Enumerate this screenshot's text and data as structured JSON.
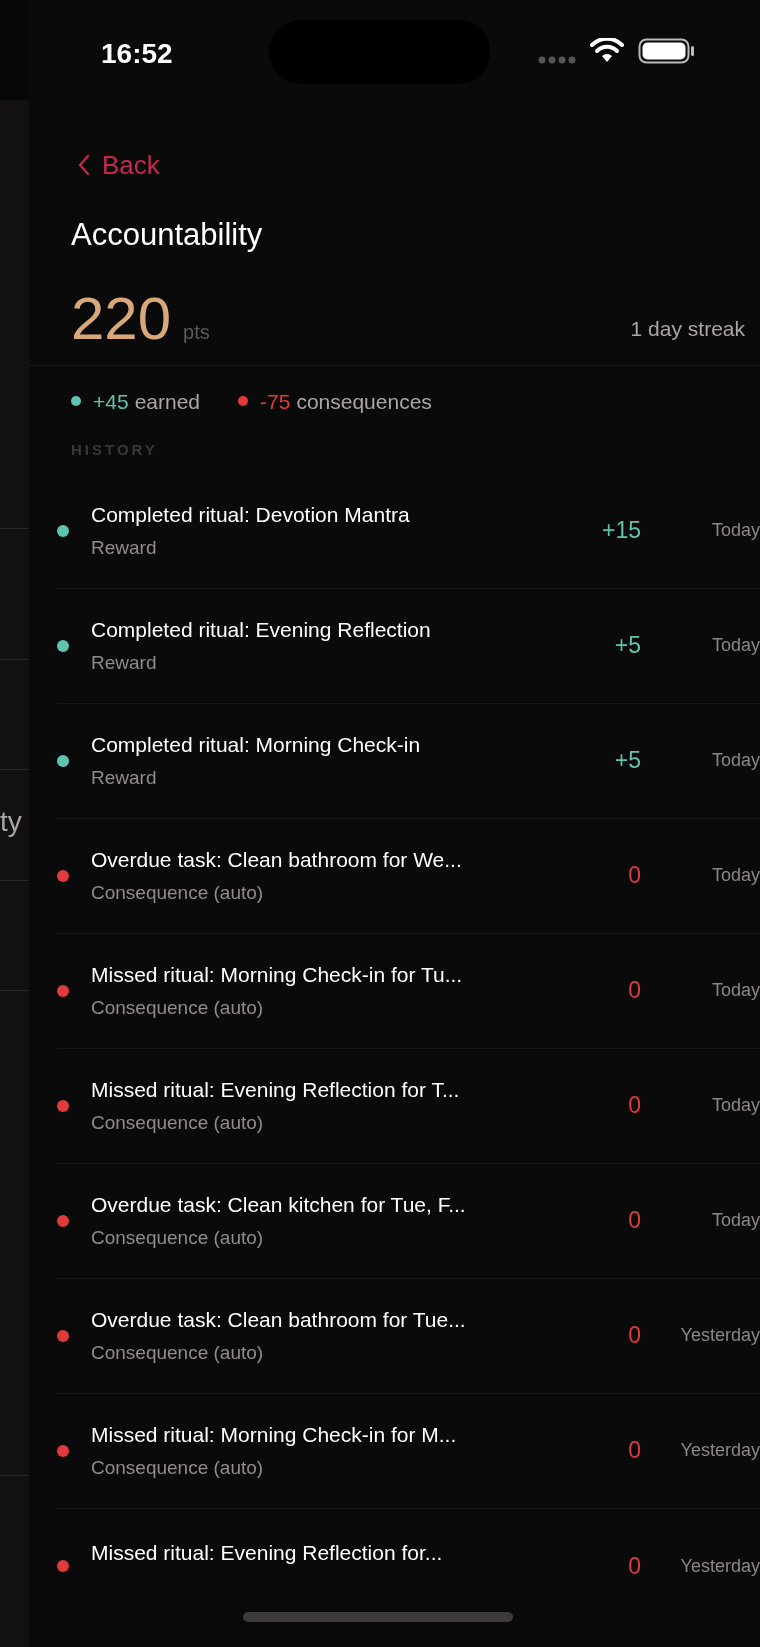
{
  "status_bar": {
    "time": "16:52"
  },
  "background_panel": {
    "text": "ty"
  },
  "back": {
    "label": "Back"
  },
  "title": "Accountability",
  "points": {
    "value": "220",
    "unit": "pts",
    "streak": "1 day streak"
  },
  "stats": [
    {
      "kind": "reward",
      "value": "+45",
      "label": "earned"
    },
    {
      "kind": "consequence",
      "value": "-75",
      "label": "consequences"
    }
  ],
  "history_heading": "HISTORY",
  "history": [
    {
      "kind": "reward",
      "title": "Completed ritual: Devotion Mantra",
      "subtitle": "Reward",
      "amount": "+15",
      "date": "Today"
    },
    {
      "kind": "reward",
      "title": "Completed ritual: Evening Reflection",
      "subtitle": "Reward",
      "amount": "+5",
      "date": "Today"
    },
    {
      "kind": "reward",
      "title": "Completed ritual: Morning Check-in",
      "subtitle": "Reward",
      "amount": "+5",
      "date": "Today"
    },
    {
      "kind": "consequence",
      "title": "Overdue task: Clean bathroom for We...",
      "subtitle": "Consequence (auto)",
      "amount": "0",
      "date": "Today"
    },
    {
      "kind": "consequence",
      "title": "Missed ritual: Morning Check-in for Tu...",
      "subtitle": "Consequence (auto)",
      "amount": "0",
      "date": "Today"
    },
    {
      "kind": "consequence",
      "title": "Missed ritual: Evening Reflection for T...",
      "subtitle": "Consequence (auto)",
      "amount": "0",
      "date": "Today"
    },
    {
      "kind": "consequence",
      "title": "Overdue task: Clean kitchen for Tue, F...",
      "subtitle": "Consequence (auto)",
      "amount": "0",
      "date": "Today"
    },
    {
      "kind": "consequence",
      "title": "Overdue task: Clean bathroom for Tue...",
      "subtitle": "Consequence (auto)",
      "amount": "0",
      "date": "Yesterday"
    },
    {
      "kind": "consequence",
      "title": "Missed ritual: Morning Check-in for M...",
      "subtitle": "Consequence (auto)",
      "amount": "0",
      "date": "Yesterday"
    },
    {
      "kind": "consequence",
      "title": "Missed ritual: Evening Reflection for...",
      "amount": "0",
      "date": "Yesterday"
    }
  ]
}
